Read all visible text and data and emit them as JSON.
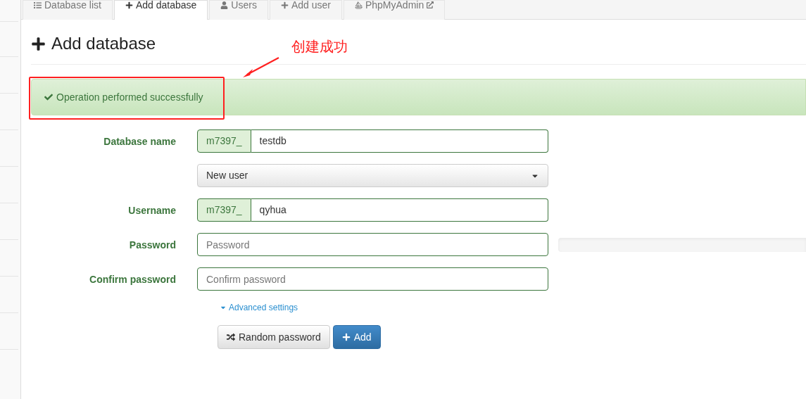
{
  "tabs": [
    {
      "label": "Database list",
      "kind": "list",
      "selected": false
    },
    {
      "label": "Add database",
      "kind": "add",
      "selected": true
    },
    {
      "label": "Users",
      "kind": "users",
      "selected": false
    },
    {
      "label": "Add user",
      "kind": "add",
      "selected": false
    },
    {
      "label": "PhpMyAdmin",
      "kind": "tool",
      "external": true,
      "selected": false
    }
  ],
  "heading": "Add database",
  "alert": {
    "text": "Operation performed successfully"
  },
  "annotation": {
    "text": "创建成功"
  },
  "form": {
    "fields": [
      {
        "kind": "prefixed",
        "label": "Database name",
        "prefix": "m7397_",
        "value": "testdb"
      },
      {
        "kind": "select",
        "value": "New user"
      },
      {
        "kind": "prefixed",
        "label": "Username",
        "prefix": "m7397_",
        "value": "qyhua"
      },
      {
        "kind": "password",
        "label": "Password",
        "placeholder": "Password",
        "level": 0
      },
      {
        "kind": "text",
        "label": "Confirm password",
        "placeholder": "Confirm password"
      }
    ],
    "advanced": "Advanced settings",
    "buttons": [
      {
        "kind": "default",
        "label": "Random password"
      },
      {
        "kind": "primary",
        "label": "Add"
      }
    ]
  }
}
